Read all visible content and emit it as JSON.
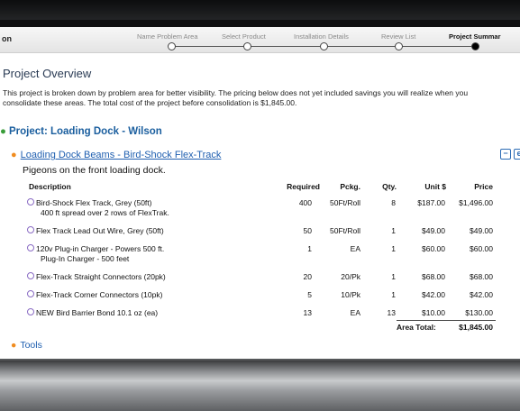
{
  "wizard": {
    "brand": "on",
    "steps": [
      {
        "label": "Name Problem Area"
      },
      {
        "label": "Select Product"
      },
      {
        "label": "Installation Details"
      },
      {
        "label": "Review List"
      },
      {
        "label": "Project Summar"
      }
    ]
  },
  "overview": {
    "title": "Project Overview",
    "intro": "This project is broken down by problem area for better visibility. The pricing below does not yet included savings you will realize when you consolidate these areas. The total cost of the project before consolidation is $1,845.00."
  },
  "project": {
    "bullet": "●",
    "title": "Project: Loading Dock - Wilson"
  },
  "area": {
    "bullet": "●",
    "link": "Loading Dock Beams - Bird-Shock Flex-Track",
    "note": "Pigeons on the front loading dock.",
    "collapse_symbol": "−",
    "edit_symbol": "e"
  },
  "table": {
    "headers": {
      "description": "Description",
      "required": "Required",
      "pckg": "Pckg.",
      "qty": "Qty.",
      "unit": "Unit $",
      "price": "Price"
    },
    "rows": [
      {
        "description": "Bird-Shock Flex Track, Grey (50ft)",
        "detail": "400 ft spread over 2 rows of FlexTrak.",
        "required": "400",
        "pckg": "50Ft/Roll",
        "qty": "8",
        "unit": "$187.00",
        "price": "$1,496.00"
      },
      {
        "description": "Flex Track Lead Out Wire, Grey (50ft)",
        "detail": "",
        "required": "50",
        "pckg": "50Ft/Roll",
        "qty": "1",
        "unit": "$49.00",
        "price": "$49.00"
      },
      {
        "description": "120v Plug-in Charger - Powers 500 ft.",
        "detail": "Plug-In Charger - 500 feet",
        "required": "1",
        "pckg": "EA",
        "qty": "1",
        "unit": "$60.00",
        "price": "$60.00"
      },
      {
        "description": "Flex-Track Straight Connectors (20pk)",
        "detail": "",
        "required": "20",
        "pckg": "20/Pk",
        "qty": "1",
        "unit": "$68.00",
        "price": "$68.00"
      },
      {
        "description": "Flex-Track Corner Connectors (10pk)",
        "detail": "",
        "required": "5",
        "pckg": "10/Pk",
        "qty": "1",
        "unit": "$42.00",
        "price": "$42.00"
      },
      {
        "description": "NEW Bird Barrier Bond 10.1 oz (ea)",
        "detail": "",
        "required": "13",
        "pckg": "EA",
        "qty": "13",
        "unit": "$10.00",
        "price": "$130.00"
      }
    ],
    "area_total_label": "Area Total:",
    "area_total_value": "$1,845.00"
  },
  "tools": {
    "bullet": "●",
    "label": "Tools"
  }
}
